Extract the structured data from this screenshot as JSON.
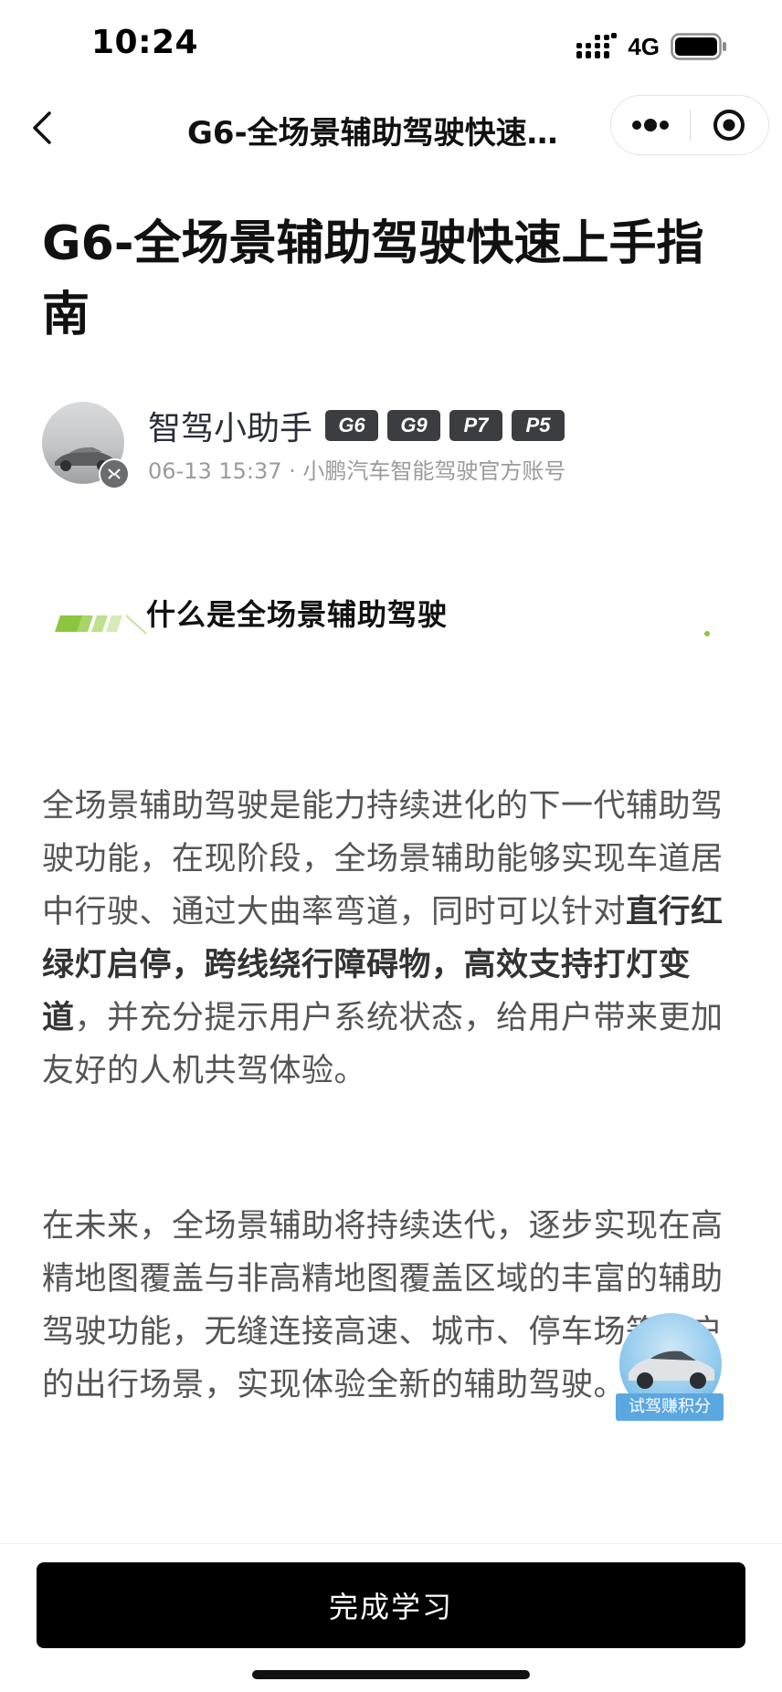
{
  "status_bar": {
    "time": "10:24",
    "network": "4G",
    "icons": [
      "signal-icon",
      "battery-icon"
    ]
  },
  "nav": {
    "title": "G6-全场景辅助驾驶快速…",
    "back_icon": "chevron-left-icon",
    "more_icon": "more-dots-icon",
    "close_icon": "target-circle-icon"
  },
  "article": {
    "title": "G6-全场景辅助驾驶快速上手指南",
    "author": {
      "name": "智驾小助手",
      "tags": [
        "G6",
        "G9",
        "P7",
        "P5"
      ],
      "meta": "06-13 15:37 · 小鹏汽车智能驾驶官方账号"
    },
    "section_heading": "什么是全场景辅助驾驶",
    "paragraph1": {
      "text_a": "全场景辅助驾驶是能力持续进化的下一代辅助驾驶功能，在现阶段，全场景辅助能够实现车道居中行驶、通过大曲率弯道，同时可以针对",
      "bold": "直行红绿灯启停，跨线绕行障碍物，高效支持打灯变道",
      "text_b": "，并充分提示用户系统状态，给用户带来更加友好的人机共驾体验。"
    },
    "paragraph2": "在未来，全场景辅助将持续迭代，逐步实现在高精地图覆盖与非高精地图覆盖区域的丰富的辅助驾驶功能，无缝连接高速、城市、停车场等用户的出行场景，实现体验全新的辅助驾驶。"
  },
  "promo": {
    "label": "试驾赚积分"
  },
  "bottom": {
    "complete_button": "完成学习"
  },
  "colors": {
    "accent_green": "#8cc63f",
    "tag_bg": "#3c3d41",
    "promo_blue": "#5aa7e2"
  }
}
